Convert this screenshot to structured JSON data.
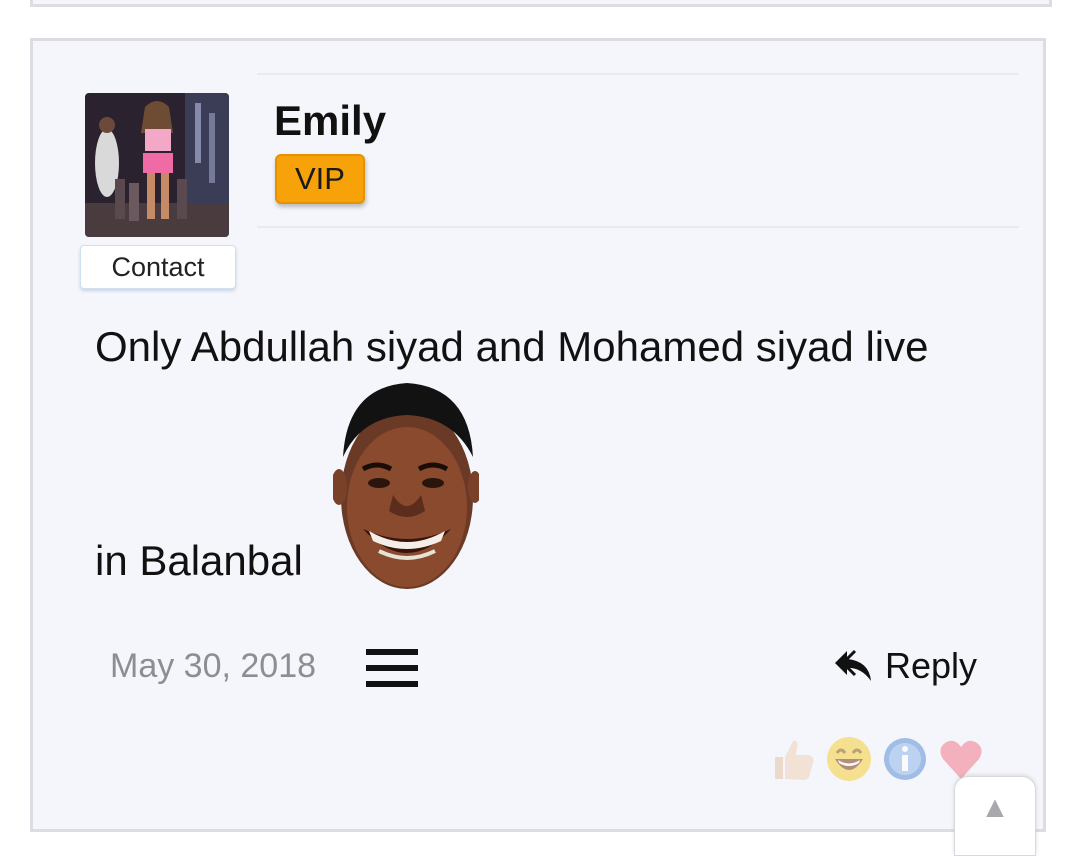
{
  "post": {
    "username": "Emily",
    "badge": "VIP",
    "contact_label": "Contact",
    "message_line1": "Only Abdullah siyad and Mohamed siyad live",
    "message_line2": "in Balanbal",
    "date": "May 30, 2018",
    "reply_label": "Reply",
    "sticker": "grinning-face-sticker"
  },
  "reactions": [
    {
      "name": "like",
      "icon": "thumbs-up-icon"
    },
    {
      "name": "laugh",
      "icon": "laughing-face-icon"
    },
    {
      "name": "info",
      "icon": "info-icon"
    },
    {
      "name": "love",
      "icon": "heart-icon"
    }
  ],
  "scroll_top": {
    "glyph": "▲"
  },
  "colors": {
    "card_background": "#f5f6fb",
    "card_border": "#dcdce2",
    "badge": "#f8a20a",
    "date_text": "#8d8d93"
  }
}
